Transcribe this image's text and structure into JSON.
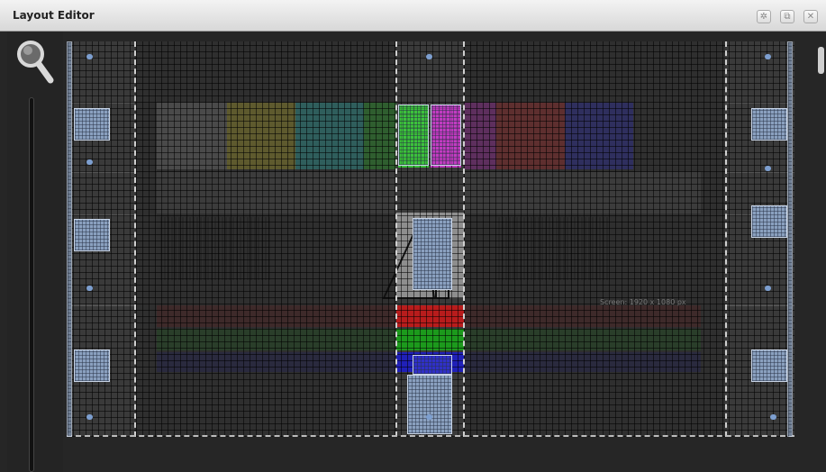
{
  "window": {
    "title": "Layout Editor",
    "buttons": {
      "settings_icon": "gear-icon",
      "restore_icon": "restore-icon",
      "close_icon": "close-icon"
    }
  },
  "sidebar": {
    "zoom_icon": "magnifier-icon",
    "zoom_slider_label": ""
  },
  "canvas": {
    "resolution_label": "Screen: 1920 x 1080 px",
    "colors": {
      "background": "#262626",
      "tile": "#8aa0bf",
      "bar_red": "#b81c1c",
      "bar_green": "#1c9a1c",
      "bar_blue": "#2020b8",
      "magenta": "#c23cc2",
      "green_block": "#3cc23c"
    }
  }
}
